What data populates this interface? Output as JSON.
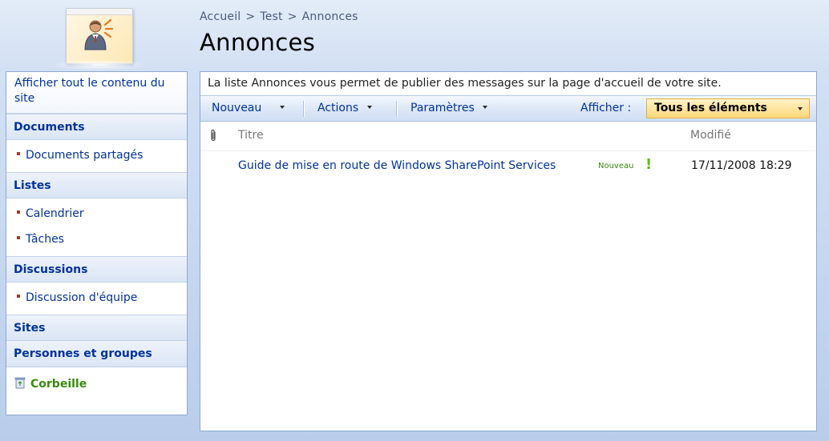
{
  "breadcrumb": {
    "items": [
      "Accueil",
      "Test",
      "Annonces"
    ],
    "separator": ">"
  },
  "page": {
    "title": "Annonces",
    "description": "La liste Annonces vous permet de publier des messages sur la page d'accueil de votre site."
  },
  "quicklaunch": {
    "view_all": "Afficher tout le contenu du site",
    "sections": [
      {
        "header": "Documents",
        "items": [
          "Documents partagés"
        ]
      },
      {
        "header": "Listes",
        "items": [
          "Calendrier",
          "Tâches"
        ]
      },
      {
        "header": "Discussions",
        "items": [
          "Discussion d'équipe"
        ]
      },
      {
        "header": "Sites",
        "items": []
      },
      {
        "header": "Personnes et groupes",
        "items": []
      }
    ],
    "recycle_bin": "Corbeille"
  },
  "toolbar": {
    "new_label": "Nouveau",
    "actions_label": "Actions",
    "settings_label": "Paramètres",
    "view_label": "Afficher :",
    "view_selected": "Tous les éléments"
  },
  "list": {
    "columns": {
      "title": "Titre",
      "modified": "Modifié"
    },
    "rows": [
      {
        "title": "Guide de mise en route de Windows SharePoint Services",
        "badge": "Nouveau",
        "badge_mark": "!",
        "modified": "17/11/2008 18:29"
      }
    ]
  },
  "colors": {
    "link": "#003399",
    "accent_green": "#3a8a10",
    "view_highlight": "#ffd77a",
    "border": "#8fa9cf"
  },
  "icons": {
    "logo": "site-logo-person-icon",
    "attachment": "paperclip-icon",
    "recycle": "recycle-bin-icon",
    "dropdown": "dropdown-arrow-icon"
  }
}
